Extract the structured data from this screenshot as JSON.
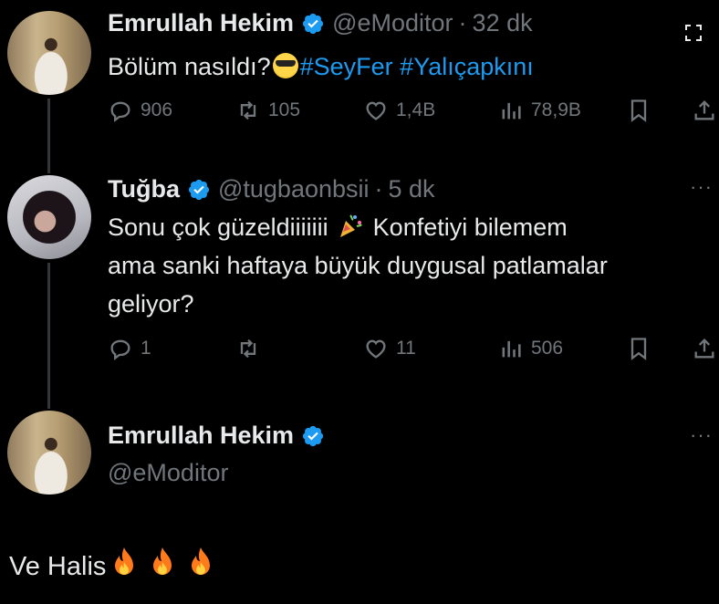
{
  "tweets": [
    {
      "name": "Emrullah Hekim",
      "handle": "@eModitor",
      "dot": "·",
      "time": "32 dk",
      "text": "Bölüm nasıldı?",
      "hashtags": [
        "#SeyFer",
        "#Yalıçapkını"
      ],
      "stats": {
        "replies": "906",
        "retweets": "105",
        "likes": "1,4B",
        "views": "78,9B"
      }
    },
    {
      "name": "Tuğba",
      "handle": "@tugbaonbsii",
      "dot": "·",
      "time": "5 dk",
      "text_line1": "Sonu çok güzeldiiiiiii",
      "text_line1b": "Konfetiyi bilemem",
      "text_line2": "ama sanki haftaya büyük duygusal patlamalar",
      "text_line3": "geliyor?",
      "stats": {
        "replies": "1",
        "retweets": "",
        "likes": "11",
        "views": "506"
      }
    },
    {
      "name": "Emrullah Hekim",
      "handle": "@eModitor",
      "text": "Ve Halis"
    }
  ],
  "colors": {
    "accent": "#1d9bf0",
    "muted": "#71767b",
    "text": "#e7e9ea",
    "background": "#000000"
  },
  "icons": [
    "reply-icon",
    "retweet-icon",
    "like-icon",
    "views-icon",
    "bookmark-icon",
    "share-icon",
    "verified-icon",
    "more-icon",
    "expand-icon",
    "fire-emoji",
    "sunglasses-emoji",
    "party-popper-emoji"
  ]
}
